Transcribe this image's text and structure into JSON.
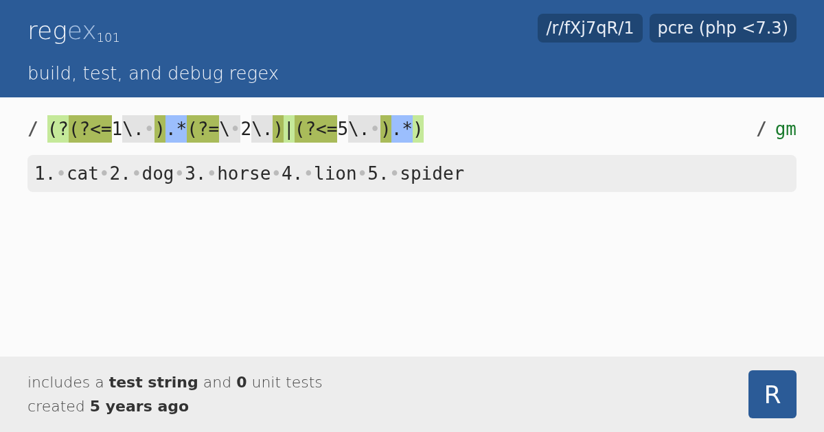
{
  "header": {
    "logo": {
      "main": "reg",
      "accent": "ex",
      "sub": "101"
    },
    "tagline": "build, test, and debug regex",
    "badges": [
      "/r/fXj7qR/1",
      "pcre (php <7.3)"
    ]
  },
  "regex": {
    "open": "/",
    "close": "/",
    "flags": "gm",
    "tokens": [
      {
        "text": "(?",
        "kind": "group"
      },
      {
        "text": "(?<=",
        "kind": "look"
      },
      {
        "text": "1",
        "kind": "plain"
      },
      {
        "text": "\\.",
        "kind": "escape"
      },
      {
        "text": "•",
        "kind": "escape-space"
      },
      {
        "text": ")",
        "kind": "look"
      },
      {
        "text": ".*",
        "kind": "quant"
      },
      {
        "text": "(?=",
        "kind": "look"
      },
      {
        "text": "\\",
        "kind": "escape"
      },
      {
        "text": "•",
        "kind": "escape-space"
      },
      {
        "text": "2",
        "kind": "plain"
      },
      {
        "text": "\\.",
        "kind": "escape"
      },
      {
        "text": ")",
        "kind": "look"
      },
      {
        "text": "|",
        "kind": "group"
      },
      {
        "text": "(?<=",
        "kind": "look"
      },
      {
        "text": "5",
        "kind": "plain"
      },
      {
        "text": "\\.",
        "kind": "escape"
      },
      {
        "text": "•",
        "kind": "escape-space"
      },
      {
        "text": ")",
        "kind": "look"
      },
      {
        "text": ".*",
        "kind": "quant"
      },
      {
        "text": ")",
        "kind": "group"
      }
    ]
  },
  "test_string": [
    {
      "text": "1.",
      "kind": "text"
    },
    {
      "text": "•",
      "kind": "space"
    },
    {
      "text": "cat",
      "kind": "text"
    },
    {
      "text": "•",
      "kind": "space"
    },
    {
      "text": "2.",
      "kind": "text"
    },
    {
      "text": "•",
      "kind": "space"
    },
    {
      "text": "dog",
      "kind": "text"
    },
    {
      "text": "•",
      "kind": "space"
    },
    {
      "text": "3.",
      "kind": "text"
    },
    {
      "text": "•",
      "kind": "space"
    },
    {
      "text": "horse",
      "kind": "text"
    },
    {
      "text": "•",
      "kind": "space"
    },
    {
      "text": "4.",
      "kind": "text"
    },
    {
      "text": "•",
      "kind": "space"
    },
    {
      "text": "lion",
      "kind": "text"
    },
    {
      "text": "•",
      "kind": "space"
    },
    {
      "text": "5.",
      "kind": "text"
    },
    {
      "text": "•",
      "kind": "space"
    },
    {
      "text": "spider",
      "kind": "text"
    }
  ],
  "footer": {
    "lines": [
      "includes a **test string** and **0** unit tests",
      "created **5 years ago**"
    ],
    "avatar": "R"
  }
}
